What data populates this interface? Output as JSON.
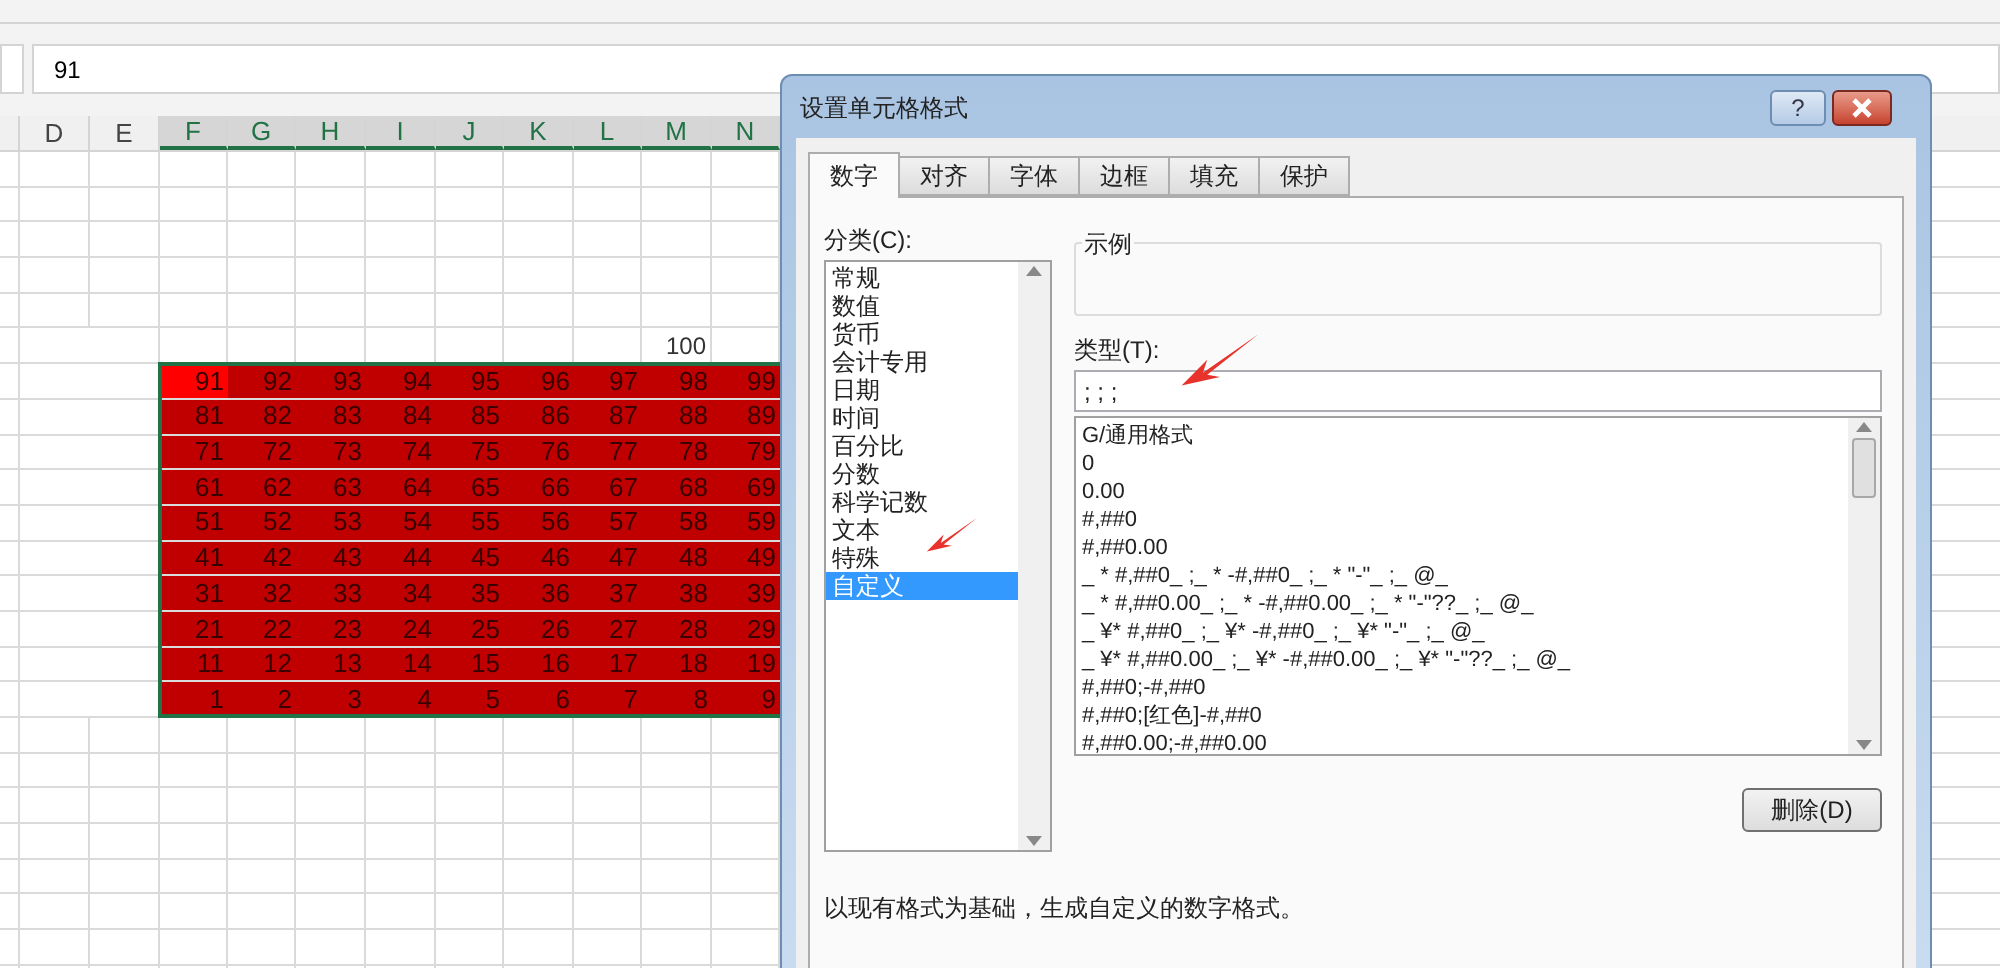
{
  "formula_bar": {
    "value": "91"
  },
  "sheet": {
    "columns": [
      {
        "label": "D",
        "selected": false
      },
      {
        "label": "E",
        "selected": false
      },
      {
        "label": "F",
        "selected": true
      },
      {
        "label": "G",
        "selected": true
      },
      {
        "label": "H",
        "selected": true
      },
      {
        "label": "I",
        "selected": true
      },
      {
        "label": "J",
        "selected": true
      },
      {
        "label": "K",
        "selected": true
      },
      {
        "label": "L",
        "selected": true
      },
      {
        "label": "M",
        "selected": true
      },
      {
        "label": "N",
        "selected": true
      }
    ],
    "label_cell": {
      "text": "100"
    },
    "rows": [
      [
        {
          "text": "91",
          "selected": true
        },
        {
          "text": "92",
          "selected": false
        },
        {
          "text": "93",
          "selected": false
        },
        {
          "text": "94",
          "selected": false
        },
        {
          "text": "95",
          "selected": false
        },
        {
          "text": "96",
          "selected": false
        },
        {
          "text": "97",
          "selected": false
        },
        {
          "text": "98",
          "selected": false
        },
        {
          "text": "99",
          "selected": false
        }
      ],
      [
        {
          "text": "81",
          "selected": false
        },
        {
          "text": "82",
          "selected": false
        },
        {
          "text": "83",
          "selected": false
        },
        {
          "text": "84",
          "selected": false
        },
        {
          "text": "85",
          "selected": false
        },
        {
          "text": "86",
          "selected": false
        },
        {
          "text": "87",
          "selected": false
        },
        {
          "text": "88",
          "selected": false
        },
        {
          "text": "89",
          "selected": false
        }
      ],
      [
        {
          "text": "71",
          "selected": false
        },
        {
          "text": "72",
          "selected": false
        },
        {
          "text": "73",
          "selected": false
        },
        {
          "text": "74",
          "selected": false
        },
        {
          "text": "75",
          "selected": false
        },
        {
          "text": "76",
          "selected": false
        },
        {
          "text": "77",
          "selected": false
        },
        {
          "text": "78",
          "selected": false
        },
        {
          "text": "79",
          "selected": false
        }
      ],
      [
        {
          "text": "61",
          "selected": false
        },
        {
          "text": "62",
          "selected": false
        },
        {
          "text": "63",
          "selected": false
        },
        {
          "text": "64",
          "selected": false
        },
        {
          "text": "65",
          "selected": false
        },
        {
          "text": "66",
          "selected": false
        },
        {
          "text": "67",
          "selected": false
        },
        {
          "text": "68",
          "selected": false
        },
        {
          "text": "69",
          "selected": false
        }
      ],
      [
        {
          "text": "51",
          "selected": false
        },
        {
          "text": "52",
          "selected": false
        },
        {
          "text": "53",
          "selected": false
        },
        {
          "text": "54",
          "selected": false
        },
        {
          "text": "55",
          "selected": false
        },
        {
          "text": "56",
          "selected": false
        },
        {
          "text": "57",
          "selected": false
        },
        {
          "text": "58",
          "selected": false
        },
        {
          "text": "59",
          "selected": false
        }
      ],
      [
        {
          "text": "41",
          "selected": false
        },
        {
          "text": "42",
          "selected": false
        },
        {
          "text": "43",
          "selected": false
        },
        {
          "text": "44",
          "selected": false
        },
        {
          "text": "45",
          "selected": false
        },
        {
          "text": "46",
          "selected": false
        },
        {
          "text": "47",
          "selected": false
        },
        {
          "text": "48",
          "selected": false
        },
        {
          "text": "49",
          "selected": false
        }
      ],
      [
        {
          "text": "31",
          "selected": false
        },
        {
          "text": "32",
          "selected": false
        },
        {
          "text": "33",
          "selected": false
        },
        {
          "text": "34",
          "selected": false
        },
        {
          "text": "35",
          "selected": false
        },
        {
          "text": "36",
          "selected": false
        },
        {
          "text": "37",
          "selected": false
        },
        {
          "text": "38",
          "selected": false
        },
        {
          "text": "39",
          "selected": false
        }
      ],
      [
        {
          "text": "21",
          "selected": false
        },
        {
          "text": "22",
          "selected": false
        },
        {
          "text": "23",
          "selected": false
        },
        {
          "text": "24",
          "selected": false
        },
        {
          "text": "25",
          "selected": false
        },
        {
          "text": "26",
          "selected": false
        },
        {
          "text": "27",
          "selected": false
        },
        {
          "text": "28",
          "selected": false
        },
        {
          "text": "29",
          "selected": false
        }
      ],
      [
        {
          "text": "11",
          "selected": false
        },
        {
          "text": "12",
          "selected": false
        },
        {
          "text": "13",
          "selected": false
        },
        {
          "text": "14",
          "selected": false
        },
        {
          "text": "15",
          "selected": false
        },
        {
          "text": "16",
          "selected": false
        },
        {
          "text": "17",
          "selected": false
        },
        {
          "text": "18",
          "selected": false
        },
        {
          "text": "19",
          "selected": false
        }
      ],
      [
        {
          "text": "1",
          "selected": false
        },
        {
          "text": "2",
          "selected": false
        },
        {
          "text": "3",
          "selected": false
        },
        {
          "text": "4",
          "selected": false
        },
        {
          "text": "5",
          "selected": false
        },
        {
          "text": "6",
          "selected": false
        },
        {
          "text": "7",
          "selected": false
        },
        {
          "text": "8",
          "selected": false
        },
        {
          "text": "9",
          "selected": false
        }
      ]
    ]
  },
  "dialog": {
    "title": "设置单元格格式",
    "help": "?",
    "tabs": [
      {
        "label": "数字",
        "selected": true
      },
      {
        "label": "对齐",
        "selected": false
      },
      {
        "label": "字体",
        "selected": false
      },
      {
        "label": "边框",
        "selected": false
      },
      {
        "label": "填充",
        "selected": false
      },
      {
        "label": "保护",
        "selected": false
      }
    ],
    "category_label": "分类(C):",
    "categories": [
      {
        "label": "常规",
        "selected": false
      },
      {
        "label": "数值",
        "selected": false
      },
      {
        "label": "货币",
        "selected": false
      },
      {
        "label": "会计专用",
        "selected": false
      },
      {
        "label": "日期",
        "selected": false
      },
      {
        "label": "时间",
        "selected": false
      },
      {
        "label": "百分比",
        "selected": false
      },
      {
        "label": "分数",
        "selected": false
      },
      {
        "label": "科学记数",
        "selected": false
      },
      {
        "label": "文本",
        "selected": false
      },
      {
        "label": "特殊",
        "selected": false
      },
      {
        "label": "自定义",
        "selected": true
      }
    ],
    "sample_label": "示例",
    "type_label": "类型(T):",
    "type_value": "; ; ;",
    "formats": [
      "G/通用格式",
      "0",
      "0.00",
      "#,##0",
      "#,##0.00",
      "_ * #,##0_ ;_ * -#,##0_ ;_ * \"-\"_ ;_ @_",
      "_ * #,##0.00_ ;_ * -#,##0.00_ ;_ * \"-\"??_ ;_ @_",
      "_ ¥* #,##0_ ;_ ¥* -#,##0_ ;_ ¥* \"-\"_ ;_ @_",
      "_ ¥* #,##0.00_ ;_ ¥* -#,##0.00_ ;_ ¥* \"-\"??_ ;_ @_",
      "#,##0;-#,##0",
      "#,##0;[红色]-#,##0",
      "#,##0.00;-#,##0.00"
    ],
    "delete_button": "删除(D)",
    "description": "以现有格式为基础，生成自定义的数字格式。"
  }
}
